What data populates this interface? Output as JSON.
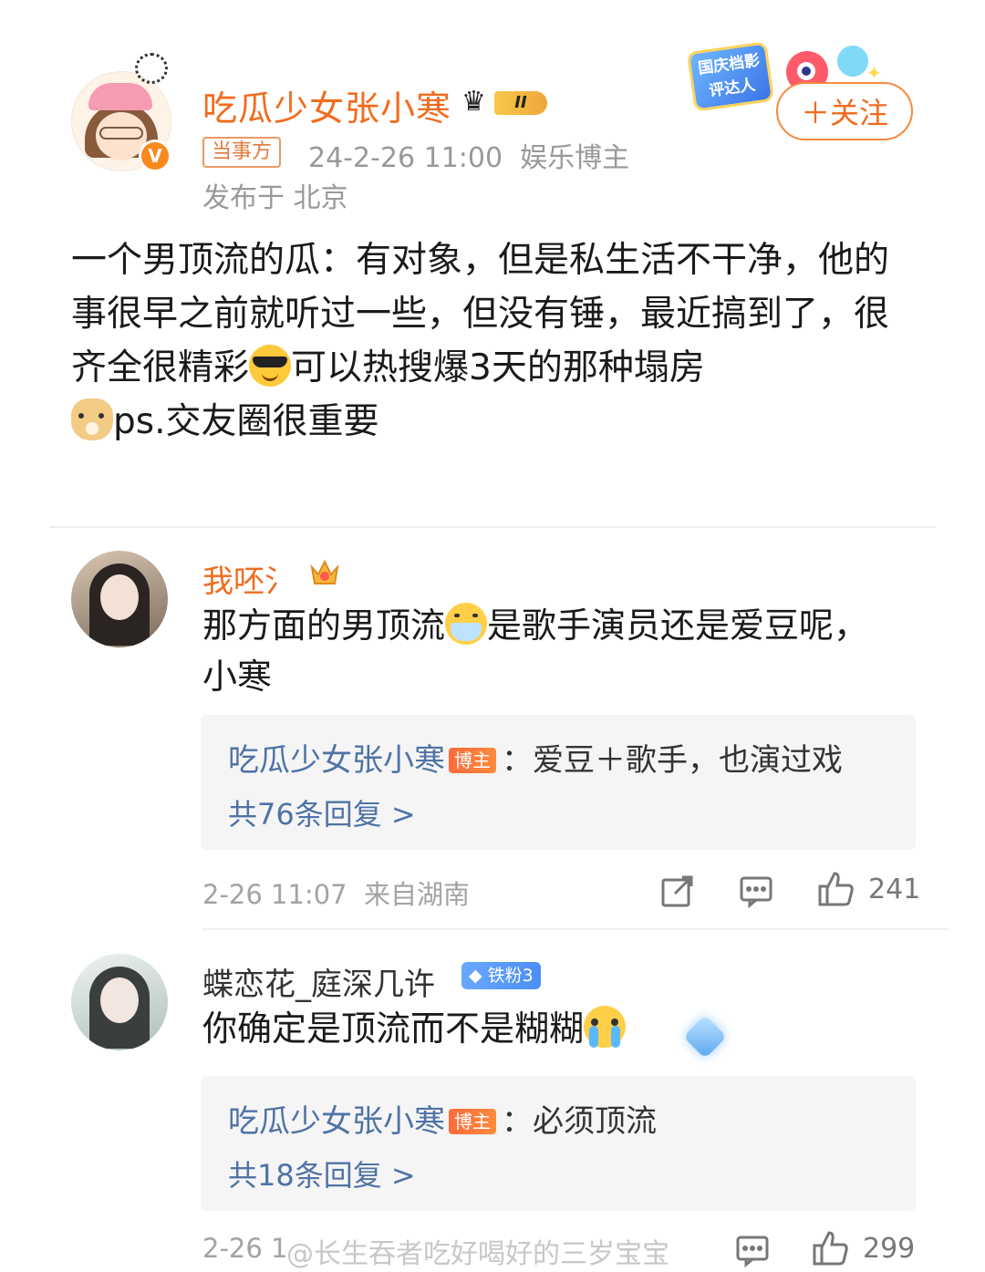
{
  "post": {
    "author_name": "吃瓜少女张小寒",
    "level_badge": "II",
    "verified_mark": "V",
    "role_tag": "当事方",
    "time_and_category": "24-2-26 11:00  娱乐博主",
    "location": "发布于 北京",
    "promo_badge": "国庆档影评达人",
    "follow_label": "＋关注",
    "body_part1": "一个男顶流的瓜：有对象，但是私生活不干净，他的事很早之前就听过一些，但没有锤，最近搞到了，很齐全很精彩",
    "body_part2": "可以热搜爆3天的那种塌房",
    "body_part3": "ps.交友圈很重要",
    "emojis": [
      "cool-sunglasses-emoji",
      "doge-emoji"
    ]
  },
  "comments": [
    {
      "user": "我呸氵",
      "badge_icon": "vip-crown-icon",
      "text_part1": "那方面的男顶流",
      "text_part2": "是歌手演员还是爱豆呢，小寒",
      "reply_author": "吃瓜少女张小寒",
      "reply_tag": "博主",
      "reply_text": "：爱豆＋歌手，也演过戏",
      "reply_count": "共76条回复 >",
      "meta": "2-26 11:07  来自湖南",
      "likes": "241"
    },
    {
      "user": "蝶恋花_庭深几许",
      "badge": "铁粉3",
      "text": "你确定是顶流而不是糊糊",
      "reply_author": "吃瓜少女张小寒",
      "reply_tag": "博主",
      "reply_text": "：必须顶流",
      "reply_count": "共18条回复 >",
      "meta": "2-26 1",
      "likes": "299"
    }
  ],
  "watermark": "@长生吞者吃好喝好的三岁宝宝",
  "colors": {
    "accent_orange": "#f26b1d",
    "reply_blue": "#4f73a6",
    "meta_gray": "#a3a3a3"
  }
}
